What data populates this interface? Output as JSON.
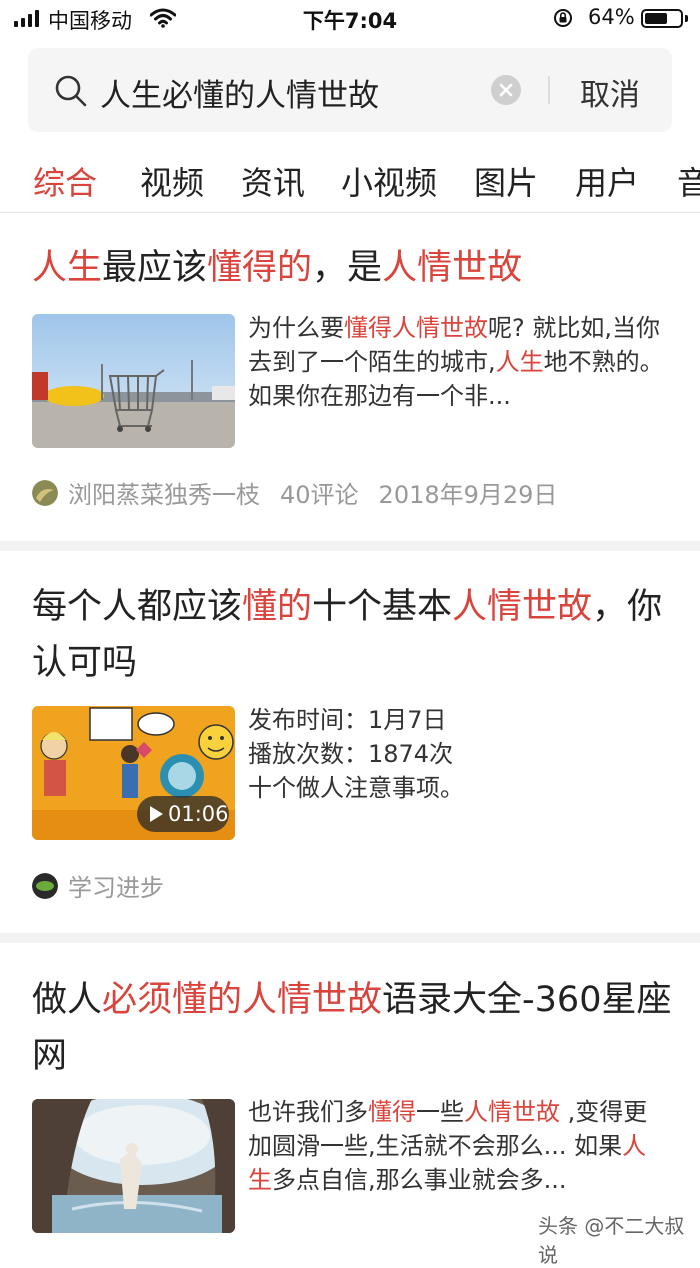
{
  "status_bar": {
    "carrier": "中国移动",
    "time": "下午7:04",
    "battery": "64%",
    "battery_level": 0.64
  },
  "search": {
    "query": "人生必懂的人情世故",
    "cancel_label": "取消"
  },
  "tabs": [
    "综合",
    "视频",
    "资讯",
    "小视频",
    "图片",
    "用户",
    "音"
  ],
  "results": [
    {
      "title": [
        {
          "t": "人生",
          "hl": true
        },
        {
          "t": "最应该",
          "hl": false
        },
        {
          "t": "懂得的",
          "hl": true
        },
        {
          "t": "，是",
          "hl": false
        },
        {
          "t": "人情世故",
          "hl": true
        }
      ],
      "description": [
        {
          "t": "为什么要",
          "hl": false
        },
        {
          "t": "懂得人情世故",
          "hl": true
        },
        {
          "t": "呢? 就比如,当你去到了一个陌生的城市,",
          "hl": false
        },
        {
          "t": "人生",
          "hl": true
        },
        {
          "t": "地不熟的。如果你在那边有一个非...",
          "hl": false
        }
      ],
      "author": "浏阳蒸菜独秀一枝",
      "comments": "40评论",
      "date": "2018年9月29日"
    },
    {
      "title": [
        {
          "t": "每个人都应该",
          "hl": false
        },
        {
          "t": "懂的",
          "hl": true
        },
        {
          "t": "十个基本",
          "hl": false
        },
        {
          "t": "人情世故",
          "hl": true
        },
        {
          "t": "，你认可吗",
          "hl": false
        }
      ],
      "description_lines": [
        "发布时间：1月7日",
        "播放次数：1874次",
        "十个做人注意事项。"
      ],
      "duration": "01:06",
      "author": "学习进步"
    },
    {
      "title": [
        {
          "t": "做人",
          "hl": false
        },
        {
          "t": "必须懂的人情世故",
          "hl": true
        },
        {
          "t": "语录大全-360星座网",
          "hl": false
        }
      ],
      "description": [
        {
          "t": "也许我们多",
          "hl": false
        },
        {
          "t": "懂得",
          "hl": true
        },
        {
          "t": "一些",
          "hl": false
        },
        {
          "t": "人情世故",
          "hl": true
        },
        {
          "t": " ,变得更加圆滑一些,生活就不会那么... 如果",
          "hl": false
        },
        {
          "t": "人生",
          "hl": true
        },
        {
          "t": "多点自信,那么事业就会多...",
          "hl": false
        }
      ]
    }
  ],
  "watermark": "头条 @不二大叔说"
}
